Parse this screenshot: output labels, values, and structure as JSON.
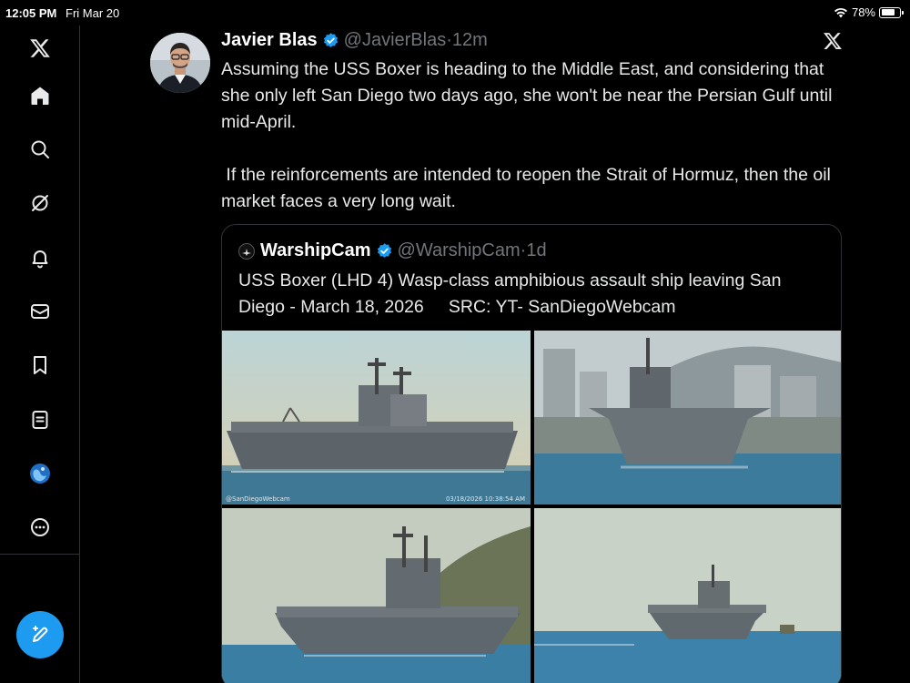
{
  "status": {
    "time": "12:05 PM",
    "date": "Fri Mar 20",
    "battery": "78%",
    "battery_level": 0.78
  },
  "sidebar": {
    "items": [
      {
        "icon": "x-logo-icon"
      },
      {
        "icon": "home-icon"
      },
      {
        "icon": "search-icon"
      },
      {
        "icon": "grok-icon"
      },
      {
        "icon": "bell-icon"
      },
      {
        "icon": "mail-icon"
      },
      {
        "icon": "bookmark-icon"
      },
      {
        "icon": "lists-icon"
      },
      {
        "icon": "profile-avatar-icon"
      },
      {
        "icon": "more-icon"
      }
    ],
    "compose_icon": "compose-icon"
  },
  "tweet": {
    "name": "Javier Blas",
    "handle": "@JavierBlas",
    "separator": "·",
    "ago": "12m",
    "paragraph1": "Assuming the USS Boxer is heading to the Middle East, and considering that she only left San Diego two days ago, she won't be near the Persian Gulf until mid-April.",
    "paragraph2": " If the reinforcements are intended to reopen the Strait of Hormuz, then the oil market faces a very long wait."
  },
  "quote": {
    "name": "WarshipCam",
    "handle": "@WarshipCam",
    "separator": "·",
    "ago": "1d",
    "text": "USS Boxer (LHD 4) Wasp-class amphibious assault ship leaving San Diego - March 18, 2026     SRC: YT- SanDiegoWebcam",
    "photos": [
      {
        "alt": "ship-photo-1",
        "watermark_left": "@SanDiegoWebcam",
        "watermark_right": "03/18/2026 10:38:54 AM"
      },
      {
        "alt": "ship-photo-2"
      },
      {
        "alt": "ship-photo-3"
      },
      {
        "alt": "ship-photo-4"
      }
    ]
  },
  "colors": {
    "accent": "#1d9bf0",
    "background": "#000000",
    "text": "#e7e9ea",
    "muted": "#71767b",
    "border": "#2f3336"
  }
}
